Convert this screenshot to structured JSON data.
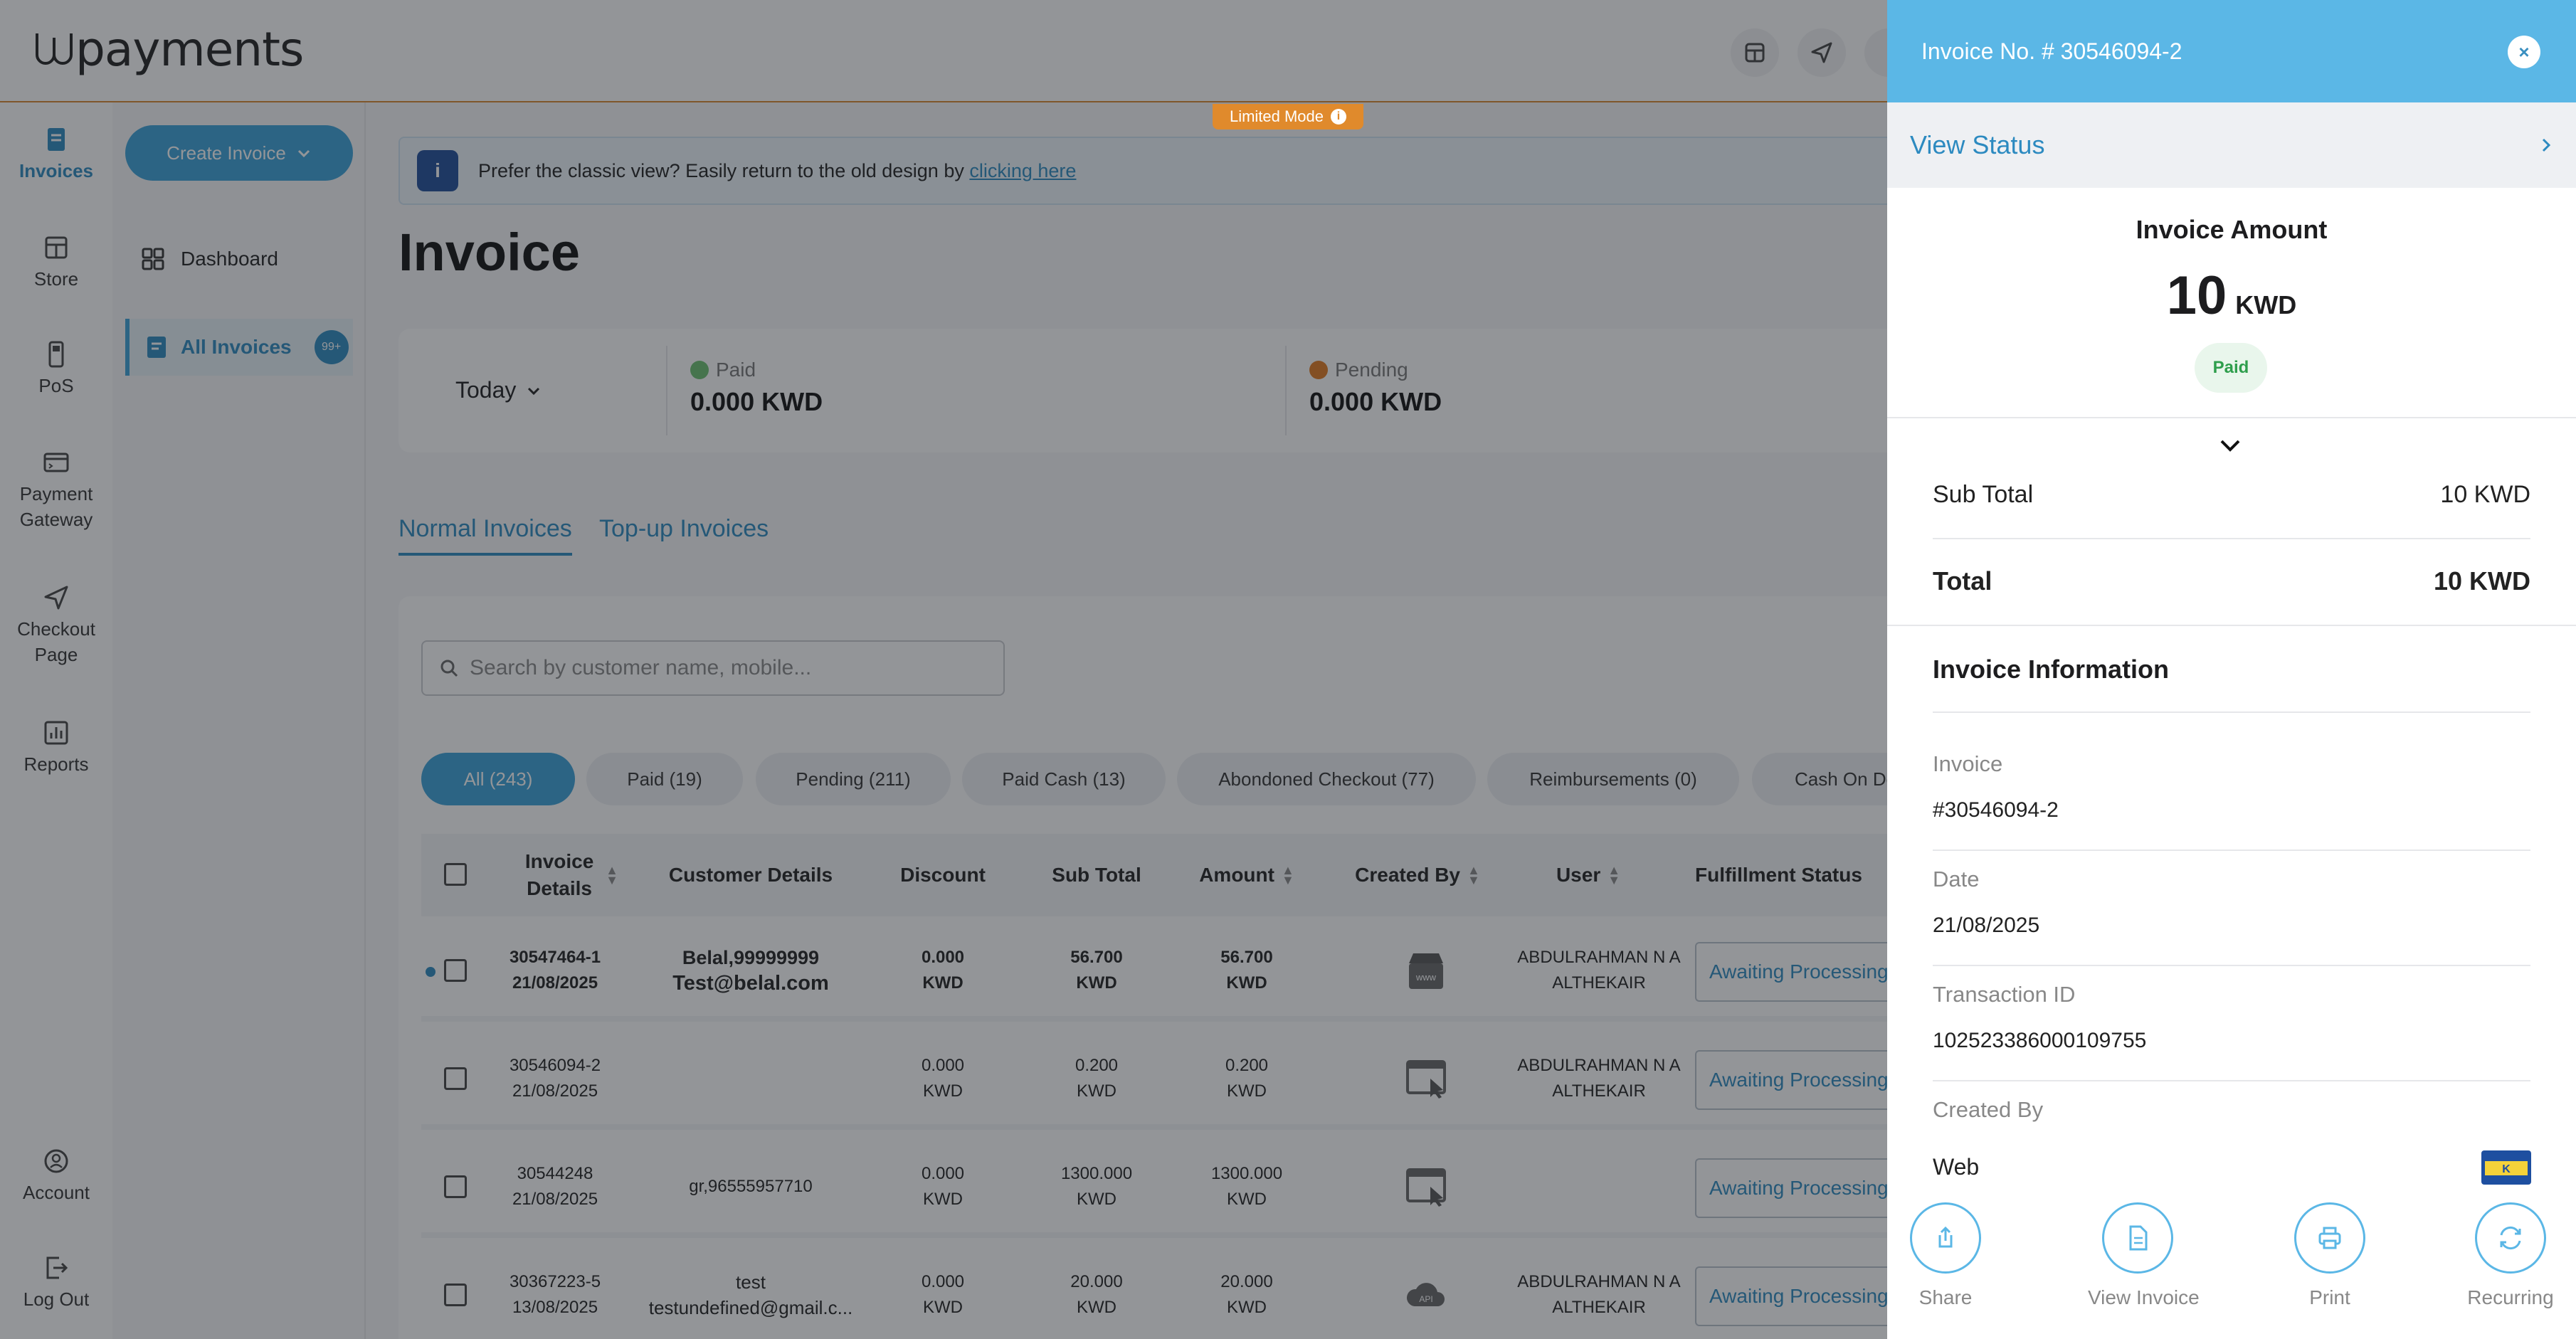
{
  "app": {
    "logo_text": "payments"
  },
  "rail": {
    "items": [
      {
        "label": "Invoices"
      },
      {
        "label": "Store"
      },
      {
        "label": "PoS"
      },
      {
        "label": "Payment Gateway"
      },
      {
        "label": "Checkout Page"
      },
      {
        "label": "Reports"
      },
      {
        "label": "Account"
      },
      {
        "label": "Log Out"
      }
    ]
  },
  "sidebar": {
    "create_label": "Create Invoice",
    "dashboard_label": "Dashboard",
    "all_invoices_label": "All Invoices",
    "all_invoices_badge": "99+"
  },
  "banner": {
    "text": "Prefer the classic view? Easily return to the old design by",
    "link": "clicking here",
    "limited_mode": "Limited Mode"
  },
  "page": {
    "title": "Invoice"
  },
  "stats": {
    "period": "Today",
    "paid_label": "Paid",
    "paid_value": "0.000 KWD",
    "pending_label": "Pending",
    "pending_value": "0.000 KWD",
    "paid_color": "#6cc070",
    "pending_color": "#e07a1f"
  },
  "tabs": [
    "Normal Invoices",
    "Top-up Invoices"
  ],
  "search": {
    "placeholder": "Search by customer name, mobile..."
  },
  "filters": [
    "All (243)",
    "Paid (19)",
    "Pending (211)",
    "Paid Cash (13)",
    "Abondoned Checkout (77)",
    "Reimbursements (0)",
    "Cash On De"
  ],
  "table": {
    "headers": {
      "invoice_details": "Invoice Details",
      "customer": "Customer Details",
      "discount": "Discount",
      "subtotal": "Sub Total",
      "amount": "Amount",
      "created_by": "Created By",
      "user": "User",
      "fulfillment": "Fulfillment Status"
    },
    "rows": [
      {
        "id": "30547464-1",
        "date": "21/08/2025",
        "customer1": "Belal,99999999",
        "customer2": "Test@belal.com",
        "discount": "0.000",
        "subtotal": "56.700",
        "amount": "56.700",
        "currency": "KWD",
        "source": "www-icon",
        "user1": "ABDULRAHMAN N A",
        "user2": "ALTHEKAIR",
        "status": "Awaiting Processing"
      },
      {
        "id": "30546094-2",
        "date": "21/08/2025",
        "customer1": "",
        "customer2": "",
        "discount": "0.000",
        "subtotal": "0.200",
        "amount": "0.200",
        "currency": "KWD",
        "source": "web-click-icon",
        "user1": "ABDULRAHMAN N A",
        "user2": "ALTHEKAIR",
        "status": "Awaiting Processing"
      },
      {
        "id": "30544248",
        "date": "21/08/2025",
        "customer1": "gr,96555957710",
        "customer2": "",
        "discount": "0.000",
        "subtotal": "1300.000",
        "amount": "1300.000",
        "currency": "KWD",
        "source": "web-click-icon",
        "user1": "",
        "user2": "",
        "status": "Awaiting Processing"
      },
      {
        "id": "30367223-5",
        "date": "13/08/2025",
        "customer1": "test",
        "customer2": "testundefined@gmail.c...",
        "discount": "0.000",
        "subtotal": "20.000",
        "amount": "20.000",
        "currency": "KWD",
        "source": "api-cloud-icon",
        "user1": "ABDULRAHMAN N A",
        "user2": "ALTHEKAIR",
        "status": "Awaiting Processing"
      }
    ]
  },
  "drawer": {
    "title": "Invoice No. # 30546094-2",
    "view_status": "View Status",
    "amount_label": "Invoice Amount",
    "amount": "10",
    "currency": "KWD",
    "status": "Paid",
    "subtotal_label": "Sub Total",
    "subtotal_value": "10 KWD",
    "total_label": "Total",
    "total_value": "10 KWD",
    "info_title": "Invoice Information",
    "invoice_label": "Invoice",
    "invoice_value": "#30546094-2",
    "date_label": "Date",
    "date_value": "21/08/2025",
    "txn_label": "Transaction ID",
    "txn_value": "102523386000109755",
    "created_label": "Created By",
    "created_value": "Web",
    "actions": [
      "Share",
      "View Invoice",
      "Print",
      "Recurring"
    ]
  }
}
